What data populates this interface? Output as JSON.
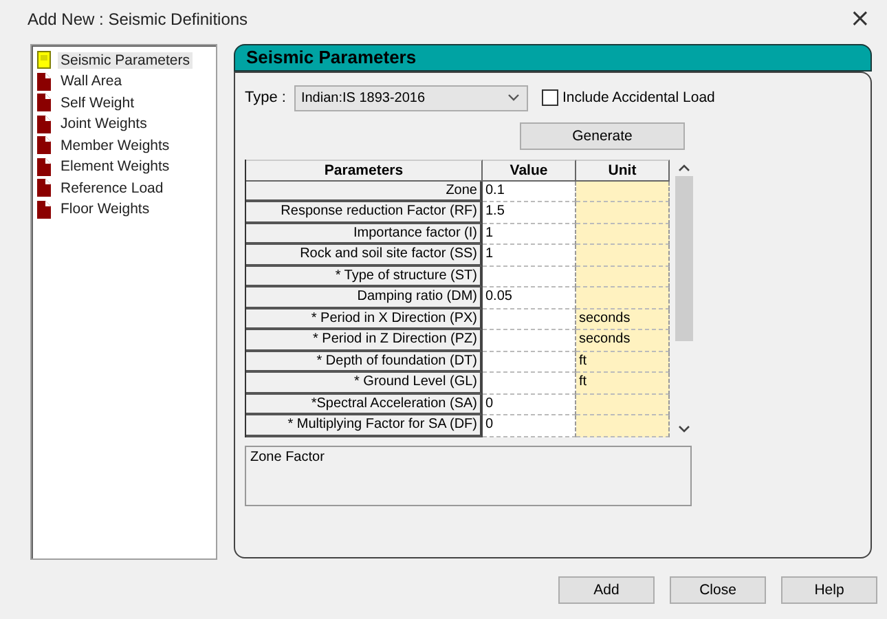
{
  "window": {
    "title": "Add New : Seismic Definitions",
    "close": "×"
  },
  "tree": [
    {
      "label": "Seismic Parameters",
      "selected": true
    },
    {
      "label": "Wall Area",
      "selected": false
    },
    {
      "label": "Self Weight",
      "selected": false
    },
    {
      "label": "Joint Weights",
      "selected": false
    },
    {
      "label": "Member Weights",
      "selected": false
    },
    {
      "label": "Element Weights",
      "selected": false
    },
    {
      "label": "Reference Load",
      "selected": false
    },
    {
      "label": "Floor Weights",
      "selected": false
    }
  ],
  "panel": {
    "title": "Seismic Parameters",
    "type_label": "Type :",
    "type_value": "Indian:IS 1893-2016",
    "accidental": {
      "label": "Include Accidental Load",
      "checked": false
    },
    "generate": "Generate"
  },
  "table": {
    "columns": [
      "Parameters",
      "Value",
      "Unit"
    ],
    "rows": [
      {
        "parameter": "Zone",
        "value": "0.1",
        "unit": ""
      },
      {
        "parameter": "Response reduction Factor (RF)",
        "value": "1.5",
        "unit": ""
      },
      {
        "parameter": "Importance factor (I)",
        "value": "1",
        "unit": ""
      },
      {
        "parameter": "Rock and soil site factor (SS)",
        "value": "1",
        "unit": ""
      },
      {
        "parameter": "* Type of structure (ST)",
        "value": "",
        "unit": ""
      },
      {
        "parameter": "Damping ratio (DM)",
        "value": "0.05",
        "unit": ""
      },
      {
        "parameter": "* Period in X Direction (PX)",
        "value": "",
        "unit": "seconds"
      },
      {
        "parameter": "* Period in Z Direction (PZ)",
        "value": "",
        "unit": "seconds"
      },
      {
        "parameter": "* Depth of foundation (DT)",
        "value": "",
        "unit": "ft"
      },
      {
        "parameter": "* Ground Level (GL)",
        "value": "",
        "unit": "ft"
      },
      {
        "parameter": "*Spectral Acceleration (SA)",
        "value": "0",
        "unit": ""
      },
      {
        "parameter": "* Multiplying Factor for SA (DF)",
        "value": "0",
        "unit": ""
      }
    ]
  },
  "description": "Zone Factor",
  "buttons": [
    "Add",
    "Close",
    "Help"
  ]
}
